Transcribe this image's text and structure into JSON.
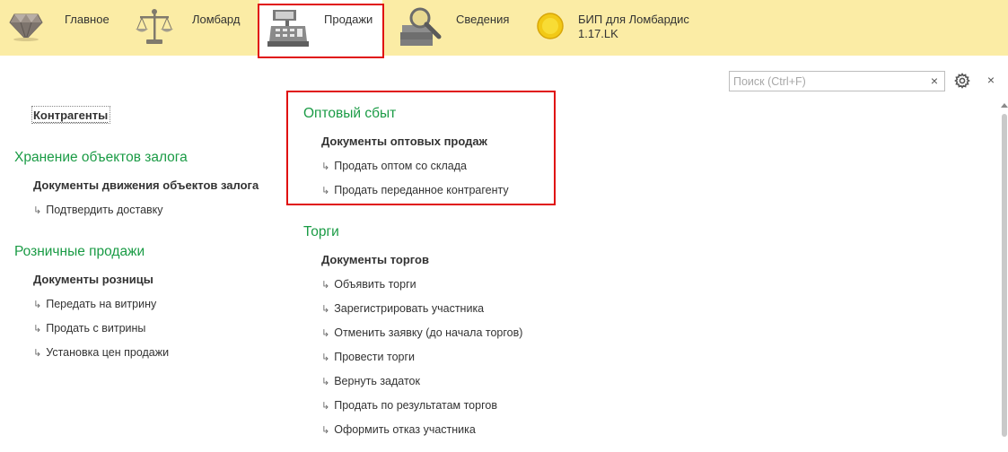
{
  "sections": [
    {
      "label": "Главное",
      "icon": "diamond-icon"
    },
    {
      "label": "Ломбард",
      "icon": "scales-icon"
    },
    {
      "label": "Продажи",
      "icon": "cash-register-icon",
      "active": true
    },
    {
      "label": "Сведения",
      "icon": "books-magnifier-icon"
    },
    {
      "label_line1": "БИП для Ломбардис",
      "label_line2": "1.17.LK",
      "icon": "coin-icon"
    }
  ],
  "search": {
    "placeholder": "Поиск (Ctrl+F)",
    "value": "",
    "clear_symbol": "×"
  },
  "close_symbol": "×",
  "left_column": {
    "top_link": "Контрагенты",
    "groups": [
      {
        "title": "Хранение объектов залога",
        "main": "Документы движения объектов залога",
        "commands": [
          "Подтвердить доставку"
        ]
      },
      {
        "title": "Розничные продажи",
        "main": "Документы розницы",
        "commands": [
          "Передать на витрину",
          "Продать с витрины",
          "Установка цен продажи"
        ]
      }
    ]
  },
  "right_column": {
    "groups": [
      {
        "title": "Оптовый сбыт",
        "main": "Документы оптовых продаж",
        "commands": [
          "Продать оптом со склада",
          "Продать переданное контрагенту"
        ]
      },
      {
        "title": "Торги",
        "main": "Документы торгов",
        "commands": [
          "Объявить торги",
          "Зарегистрировать участника",
          "Отменить заявку (до начала торгов)",
          "Провести торги",
          "Вернуть задаток",
          "Продать по результатам торгов",
          "Оформить отказ участника"
        ]
      }
    ]
  },
  "command_arrow": "↳",
  "colors": {
    "topbar": "#fbeca5",
    "group_title": "#1a9b45",
    "highlight": "#e01010"
  }
}
